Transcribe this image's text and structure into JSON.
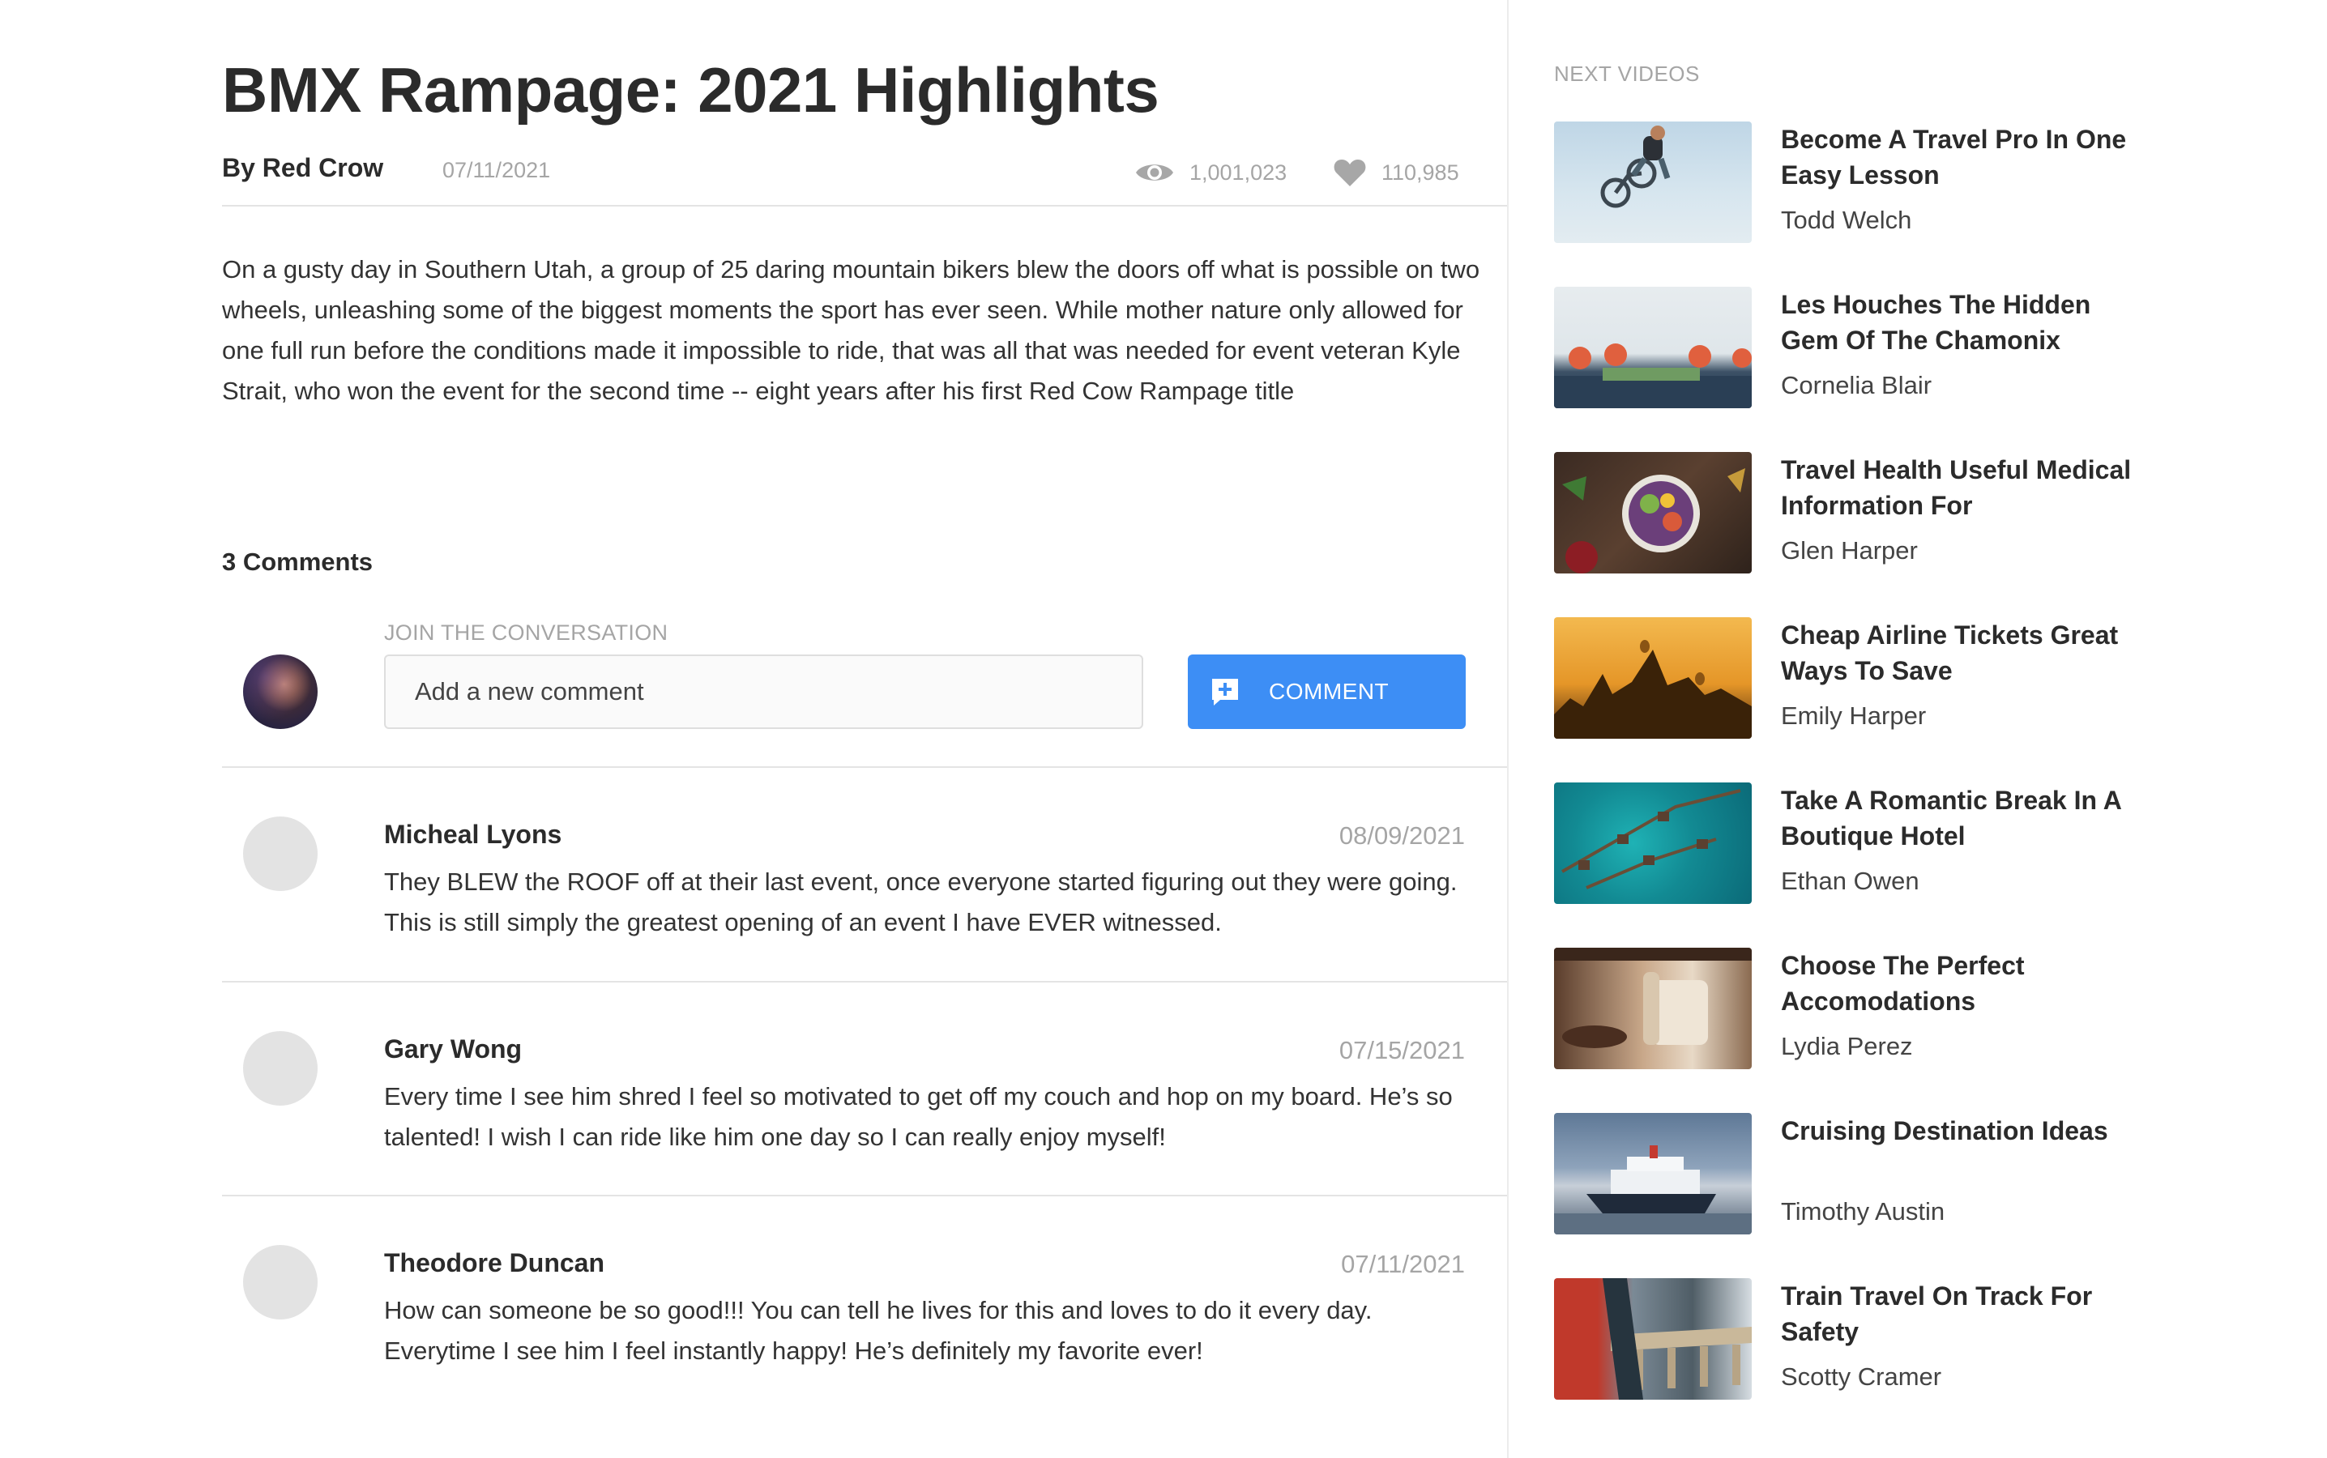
{
  "article": {
    "title": "BMX Rampage: 2021 Highlights",
    "author": "By Red Crow",
    "date": "07/11/2021",
    "views": "1,001,023",
    "likes": "110,985",
    "description": "On a gusty day in Southern Utah, a group of 25 daring mountain bikers blew the doors off what is possible on two wheels, unleashing some of the biggest moments the sport has ever seen. While mother nature only allowed for one full run before the conditions made it impossible to ride, that was all that was needed for event veteran Kyle Strait, who won the event for the second time -- eight years after his first Red Cow Rampage title"
  },
  "comments": {
    "count_label": "3 Comments",
    "join_label": "JOIN THE CONVERSATION",
    "input_placeholder": "Add a new comment",
    "button_label": "COMMENT",
    "items": [
      {
        "name": "Micheal Lyons",
        "date": "08/09/2021",
        "text": "They BLEW the ROOF off at their last event, once everyone started figuring out they were going. This is still simply the greatest opening of an event I have EVER witnessed."
      },
      {
        "name": "Gary Wong",
        "date": "07/15/2021",
        "text": "Every time I see him shred I feel so motivated to get off my couch and hop on my board. He’s so talented! I wish I can ride like him one day so I can really enjoy myself!"
      },
      {
        "name": "Theodore Duncan",
        "date": "07/11/2021",
        "text": "How can someone be so good!!! You can tell he lives for this and loves to do it every day. Everytime I see him I feel instantly happy! He’s definitely my favorite ever!"
      }
    ]
  },
  "sidebar": {
    "heading": "NEXT VIDEOS",
    "videos": [
      {
        "title": "Become A Travel Pro In One Easy Lesson",
        "author": "Todd Welch"
      },
      {
        "title": "Les Houches The Hidden Gem Of The Chamonix",
        "author": "Cornelia Blair"
      },
      {
        "title": "Travel Health Useful Medical Information For",
        "author": "Glen Harper"
      },
      {
        "title": "Cheap Airline Tickets Great Ways To Save",
        "author": "Emily Harper"
      },
      {
        "title": "Take A Romantic Break In A Boutique Hotel",
        "author": "Ethan Owen"
      },
      {
        "title": "Choose The Perfect Accomodations",
        "author": "Lydia Perez"
      },
      {
        "title": "Cruising Destination Ideas",
        "author": "Timothy Austin"
      },
      {
        "title": "Train Travel On Track For Safety",
        "author": "Scotty Cramer"
      }
    ]
  },
  "colors": {
    "accent": "#3d8ef5",
    "muted_text": "#a5a5a5",
    "heading_text": "#2b2b2b",
    "divider": "#e4e4e4"
  },
  "icons": {
    "views": "eye-icon",
    "likes": "heart-icon",
    "comment_button": "add-comment-icon"
  }
}
